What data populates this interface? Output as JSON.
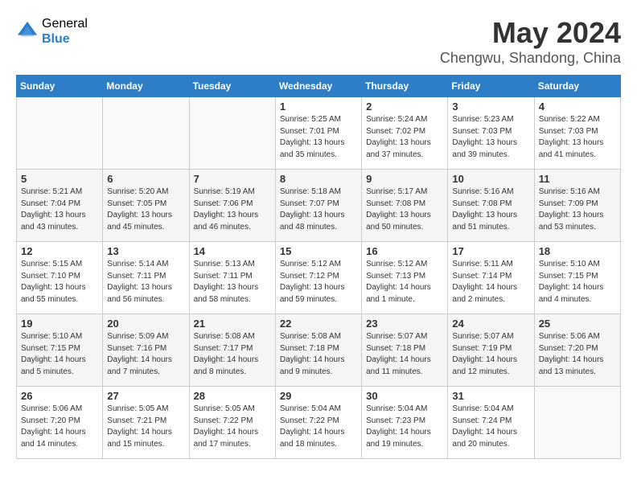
{
  "logo": {
    "general": "General",
    "blue": "Blue"
  },
  "title": "May 2024",
  "subtitle": "Chengwu, Shandong, China",
  "days_of_week": [
    "Sunday",
    "Monday",
    "Tuesday",
    "Wednesday",
    "Thursday",
    "Friday",
    "Saturday"
  ],
  "weeks": [
    [
      {
        "day": "",
        "info": ""
      },
      {
        "day": "",
        "info": ""
      },
      {
        "day": "",
        "info": ""
      },
      {
        "day": "1",
        "info": "Sunrise: 5:25 AM\nSunset: 7:01 PM\nDaylight: 13 hours\nand 35 minutes."
      },
      {
        "day": "2",
        "info": "Sunrise: 5:24 AM\nSunset: 7:02 PM\nDaylight: 13 hours\nand 37 minutes."
      },
      {
        "day": "3",
        "info": "Sunrise: 5:23 AM\nSunset: 7:03 PM\nDaylight: 13 hours\nand 39 minutes."
      },
      {
        "day": "4",
        "info": "Sunrise: 5:22 AM\nSunset: 7:03 PM\nDaylight: 13 hours\nand 41 minutes."
      }
    ],
    [
      {
        "day": "5",
        "info": "Sunrise: 5:21 AM\nSunset: 7:04 PM\nDaylight: 13 hours\nand 43 minutes."
      },
      {
        "day": "6",
        "info": "Sunrise: 5:20 AM\nSunset: 7:05 PM\nDaylight: 13 hours\nand 45 minutes."
      },
      {
        "day": "7",
        "info": "Sunrise: 5:19 AM\nSunset: 7:06 PM\nDaylight: 13 hours\nand 46 minutes."
      },
      {
        "day": "8",
        "info": "Sunrise: 5:18 AM\nSunset: 7:07 PM\nDaylight: 13 hours\nand 48 minutes."
      },
      {
        "day": "9",
        "info": "Sunrise: 5:17 AM\nSunset: 7:08 PM\nDaylight: 13 hours\nand 50 minutes."
      },
      {
        "day": "10",
        "info": "Sunrise: 5:16 AM\nSunset: 7:08 PM\nDaylight: 13 hours\nand 51 minutes."
      },
      {
        "day": "11",
        "info": "Sunrise: 5:16 AM\nSunset: 7:09 PM\nDaylight: 13 hours\nand 53 minutes."
      }
    ],
    [
      {
        "day": "12",
        "info": "Sunrise: 5:15 AM\nSunset: 7:10 PM\nDaylight: 13 hours\nand 55 minutes."
      },
      {
        "day": "13",
        "info": "Sunrise: 5:14 AM\nSunset: 7:11 PM\nDaylight: 13 hours\nand 56 minutes."
      },
      {
        "day": "14",
        "info": "Sunrise: 5:13 AM\nSunset: 7:11 PM\nDaylight: 13 hours\nand 58 minutes."
      },
      {
        "day": "15",
        "info": "Sunrise: 5:12 AM\nSunset: 7:12 PM\nDaylight: 13 hours\nand 59 minutes."
      },
      {
        "day": "16",
        "info": "Sunrise: 5:12 AM\nSunset: 7:13 PM\nDaylight: 14 hours\nand 1 minute."
      },
      {
        "day": "17",
        "info": "Sunrise: 5:11 AM\nSunset: 7:14 PM\nDaylight: 14 hours\nand 2 minutes."
      },
      {
        "day": "18",
        "info": "Sunrise: 5:10 AM\nSunset: 7:15 PM\nDaylight: 14 hours\nand 4 minutes."
      }
    ],
    [
      {
        "day": "19",
        "info": "Sunrise: 5:10 AM\nSunset: 7:15 PM\nDaylight: 14 hours\nand 5 minutes."
      },
      {
        "day": "20",
        "info": "Sunrise: 5:09 AM\nSunset: 7:16 PM\nDaylight: 14 hours\nand 7 minutes."
      },
      {
        "day": "21",
        "info": "Sunrise: 5:08 AM\nSunset: 7:17 PM\nDaylight: 14 hours\nand 8 minutes."
      },
      {
        "day": "22",
        "info": "Sunrise: 5:08 AM\nSunset: 7:18 PM\nDaylight: 14 hours\nand 9 minutes."
      },
      {
        "day": "23",
        "info": "Sunrise: 5:07 AM\nSunset: 7:18 PM\nDaylight: 14 hours\nand 11 minutes."
      },
      {
        "day": "24",
        "info": "Sunrise: 5:07 AM\nSunset: 7:19 PM\nDaylight: 14 hours\nand 12 minutes."
      },
      {
        "day": "25",
        "info": "Sunrise: 5:06 AM\nSunset: 7:20 PM\nDaylight: 14 hours\nand 13 minutes."
      }
    ],
    [
      {
        "day": "26",
        "info": "Sunrise: 5:06 AM\nSunset: 7:20 PM\nDaylight: 14 hours\nand 14 minutes."
      },
      {
        "day": "27",
        "info": "Sunrise: 5:05 AM\nSunset: 7:21 PM\nDaylight: 14 hours\nand 15 minutes."
      },
      {
        "day": "28",
        "info": "Sunrise: 5:05 AM\nSunset: 7:22 PM\nDaylight: 14 hours\nand 17 minutes."
      },
      {
        "day": "29",
        "info": "Sunrise: 5:04 AM\nSunset: 7:22 PM\nDaylight: 14 hours\nand 18 minutes."
      },
      {
        "day": "30",
        "info": "Sunrise: 5:04 AM\nSunset: 7:23 PM\nDaylight: 14 hours\nand 19 minutes."
      },
      {
        "day": "31",
        "info": "Sunrise: 5:04 AM\nSunset: 7:24 PM\nDaylight: 14 hours\nand 20 minutes."
      },
      {
        "day": "",
        "info": ""
      }
    ]
  ]
}
